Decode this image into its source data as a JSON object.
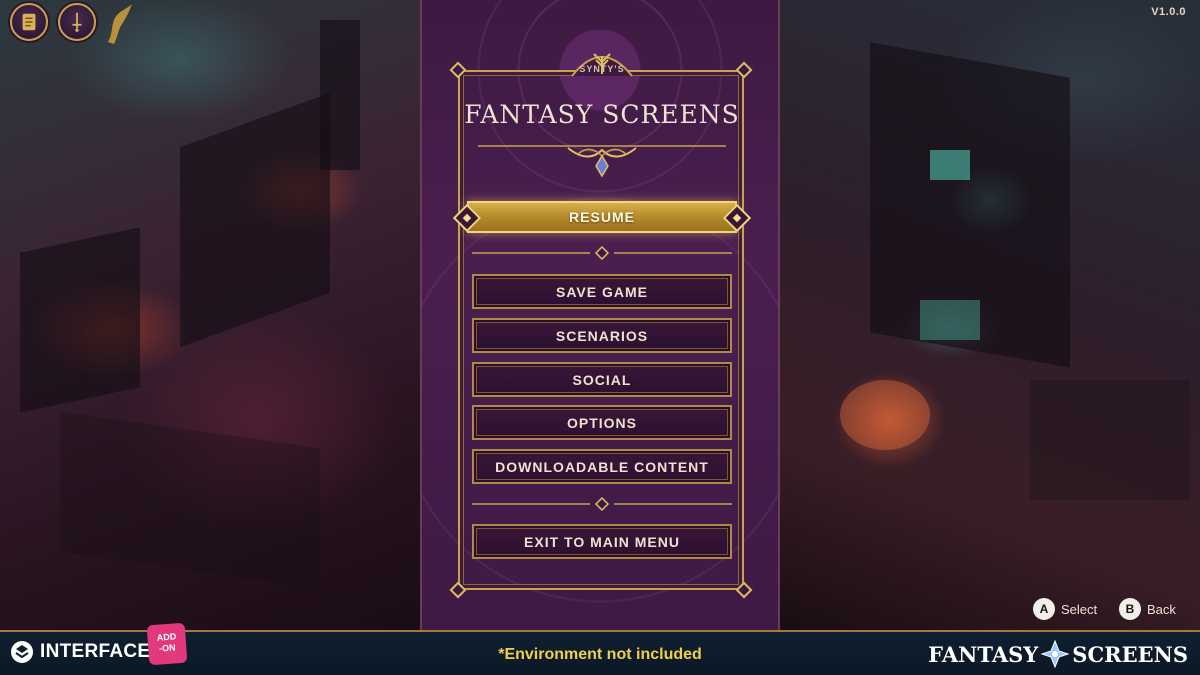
{
  "app": {
    "version": "V1.0.0"
  },
  "top_icons": [
    {
      "name": "scroll-icon"
    },
    {
      "name": "sword-icon"
    }
  ],
  "panel": {
    "subtitle": "SYNTY'S",
    "title": "FANTASY SCREENS",
    "selected": "RESUME",
    "items": [
      {
        "label": "RESUME"
      },
      {
        "label": "SAVE GAME"
      },
      {
        "label": "SCENARIOS"
      },
      {
        "label": "SOCIAL"
      },
      {
        "label": "OPTIONS"
      },
      {
        "label": "DOWNLOADABLE CONTENT"
      },
      {
        "label": "EXIT TO MAIN MENU"
      }
    ]
  },
  "hints": {
    "select": {
      "key": "A",
      "label": "Select"
    },
    "back": {
      "key": "B",
      "label": "Back"
    }
  },
  "footer": {
    "interface_label": "INTERFACE",
    "addon_line1": "ADD",
    "addon_line2": "-ON",
    "note": "*Environment not included",
    "brand_left": "FANTASY",
    "brand_right": "SCREENS"
  },
  "colors": {
    "gold": "#c9a24a",
    "panel_purple": "#4a1f4f",
    "note_yellow": "#f2cf4a",
    "addon_pink": "#e2387c",
    "footer_navy": "#0f1f30"
  }
}
